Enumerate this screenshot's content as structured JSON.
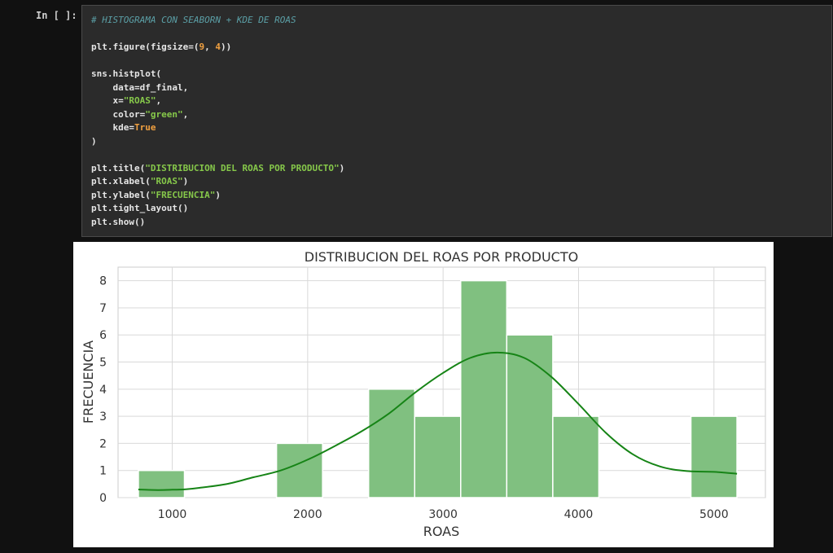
{
  "prompt": "In [ ]:",
  "code": {
    "comment": "# HISTOGRAMA CON SEABORN + KDE DE ROAS",
    "figure_prefix": "plt.figure(figsize=(",
    "figsize_w": "9",
    "figsize_sep": ", ",
    "figsize_h": "4",
    "figure_suffix": "))",
    "histplot_open": "sns.histplot(",
    "data_arg": "    data=df_final,",
    "x_prefix": "    x=",
    "x_value": "\"ROAS\"",
    "x_suffix": ",",
    "color_prefix": "    color=",
    "color_value": "\"green\"",
    "color_suffix": ",",
    "kde_prefix": "    kde=",
    "kde_value": "True",
    "histplot_close": ")",
    "title_prefix": "plt.title(",
    "title_value": "\"DISTRIBUCION DEL ROAS POR PRODUCTO\"",
    "title_suffix": ")",
    "xlabel_prefix": "plt.xlabel(",
    "xlabel_value": "\"ROAS\"",
    "xlabel_suffix": ")",
    "ylabel_prefix": "plt.ylabel(",
    "ylabel_value": "\"FRECUENCIA\"",
    "ylabel_suffix": ")",
    "tight_layout": "plt.tight_layout()",
    "show": "plt.show()"
  },
  "chart_data": {
    "type": "bar",
    "title": "DISTRIBUCION DEL ROAS POR PRODUCTO",
    "xlabel": "ROAS",
    "ylabel": "FRECUENCIA",
    "xlim": [
      600,
      5380
    ],
    "ylim": [
      0,
      8.5
    ],
    "xticks": [
      1000,
      2000,
      3000,
      4000,
      5000
    ],
    "yticks": [
      0,
      1,
      2,
      3,
      4,
      5,
      6,
      7,
      8
    ],
    "bars": [
      {
        "x0": 750,
        "x1": 1090,
        "count": 1
      },
      {
        "x0": 1090,
        "x1": 1430,
        "count": 0
      },
      {
        "x0": 1430,
        "x1": 1770,
        "count": 0
      },
      {
        "x0": 1770,
        "x1": 2110,
        "count": 2
      },
      {
        "x0": 2110,
        "x1": 2450,
        "count": 0
      },
      {
        "x0": 2450,
        "x1": 2790,
        "count": 4
      },
      {
        "x0": 2790,
        "x1": 3130,
        "count": 3
      },
      {
        "x0": 3130,
        "x1": 3470,
        "count": 8
      },
      {
        "x0": 3470,
        "x1": 3810,
        "count": 6
      },
      {
        "x0": 3810,
        "x1": 4150,
        "count": 3
      },
      {
        "x0": 4150,
        "x1": 4490,
        "count": 0
      },
      {
        "x0": 4490,
        "x1": 4830,
        "count": 0
      },
      {
        "x0": 4830,
        "x1": 5170,
        "count": 3
      }
    ],
    "kde": [
      [
        750,
        0.3
      ],
      [
        900,
        0.28
      ],
      [
        1000,
        0.29
      ],
      [
        1100,
        0.31
      ],
      [
        1200,
        0.36
      ],
      [
        1400,
        0.5
      ],
      [
        1600,
        0.75
      ],
      [
        1800,
        1.0
      ],
      [
        2000,
        1.4
      ],
      [
        2200,
        1.9
      ],
      [
        2400,
        2.45
      ],
      [
        2600,
        3.1
      ],
      [
        2800,
        3.9
      ],
      [
        3000,
        4.6
      ],
      [
        3200,
        5.15
      ],
      [
        3400,
        5.35
      ],
      [
        3600,
        5.15
      ],
      [
        3800,
        4.45
      ],
      [
        4000,
        3.45
      ],
      [
        4200,
        2.4
      ],
      [
        4400,
        1.6
      ],
      [
        4600,
        1.15
      ],
      [
        4800,
        0.98
      ],
      [
        5000,
        0.95
      ],
      [
        5170,
        0.88
      ]
    ],
    "grid": true,
    "bar_color": "#80c080",
    "bar_edge": "#ffffff",
    "kde_color": "#168416"
  }
}
